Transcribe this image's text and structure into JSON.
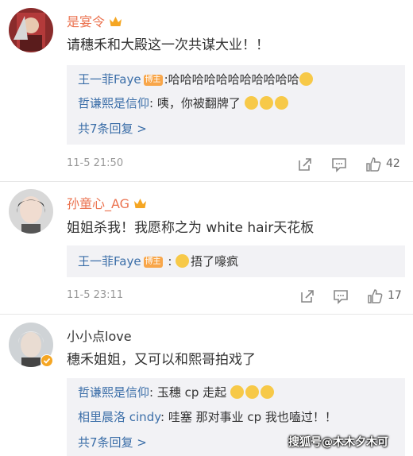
{
  "comments": [
    {
      "username": "是宴令",
      "text": "请穗禾和大殿这一次共谋大业！！",
      "replies": [
        {
          "name": "王一菲Faye",
          "badge": "博主",
          "text": ":哈哈哈哈哈哈哈哈哈哈哈"
        },
        {
          "name": "哲谦熙是信仰",
          "text": ": 咦，你被翻牌了"
        }
      ],
      "more": "共7条回复 >",
      "time": "11-5 21:50",
      "likes": "42"
    },
    {
      "username": "孙童心_AG",
      "text": "姐姐杀我！我愿称之为 white hair天花板",
      "replies": [
        {
          "name": "王一菲Faye",
          "badge": "博主",
          "text": "捂了嚎疯"
        }
      ],
      "time": "11-5 23:11",
      "likes": "17"
    },
    {
      "username": "小小点love",
      "text": "穗禾姐姐，又可以和熙哥拍戏了",
      "replies": [
        {
          "name": "哲谦熙是信仰",
          "text": ": 玉穗 cp 走起"
        },
        {
          "name": "相里晨洛 cindy",
          "text": ": 哇塞 那对事业 cp 我也嗑过！！"
        }
      ],
      "more": "共7条回复 >"
    }
  ],
  "watermark": "搜狐号@木木夕木可",
  "colors": {
    "accent": "#eb7350",
    "link": "#3b6ea8",
    "reply_bg": "#f2f2f5",
    "badge": "#f8a64a"
  }
}
